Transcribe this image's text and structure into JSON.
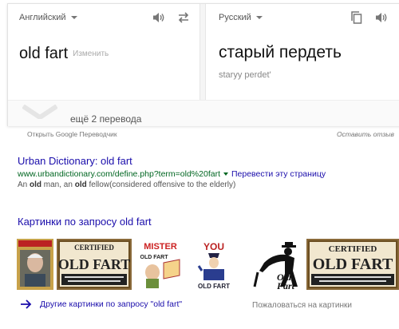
{
  "translator": {
    "source_language": "Английский",
    "target_language": "Русский",
    "source_text": "old fart",
    "edit_label": "Изменить",
    "translation": "старый пердеть",
    "transliteration": "staryy perdet'",
    "more_translations": "ещё 2 перевода",
    "open_translator_link": "Открыть Google Переводчик",
    "feedback_link": "Оставить отзыв"
  },
  "result": {
    "title": "Urban Dictionary: old fart",
    "url": "www.urbandictionary.com/define.php?term=old%20fart",
    "translate_link": "Перевести эту страницу",
    "snippet": "An old man, an old fellow(considered offensive to the elderly)"
  },
  "images": {
    "heading": "Картинки по запросу old fart",
    "thumbnails": [
      {
        "name": "image-thumbnail-book-cover-man"
      },
      {
        "name": "image-thumbnail-certified-old-fart-sign"
      },
      {
        "name": "image-thumbnail-mister-old-fart-cartoon",
        "text": "MISTER OLD FART"
      },
      {
        "name": "image-thumbnail-you-old-fart",
        "text": "YOU OLD FART"
      },
      {
        "name": "image-thumbnail-old-fart-silhouette",
        "text": "Old Fart"
      },
      {
        "name": "image-thumbnail-certified-old-fart-sign-2"
      }
    ],
    "more_images_link": "Другие картинки по запросу \"old fart\"",
    "complain_link": "Пожаловаться на картинки"
  }
}
